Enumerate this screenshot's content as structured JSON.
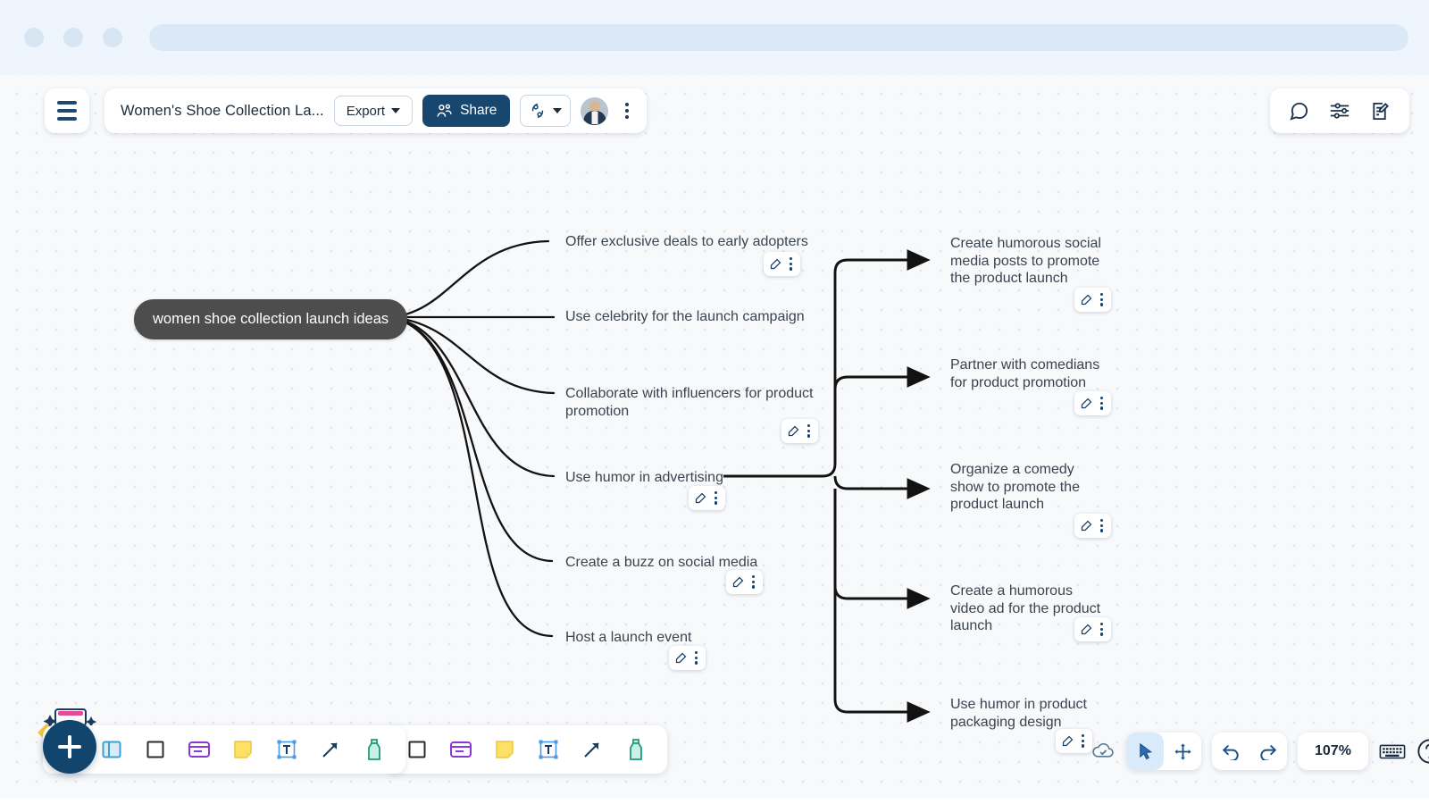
{
  "browser": {
    "dots": [
      "dot-1",
      "dot-2",
      "dot-3"
    ],
    "url_value": ""
  },
  "header": {
    "menu_icon": "hamburger-icon",
    "doc_title": "Women's Shoe Collection La...",
    "export_label": "Export",
    "share_label": "Share",
    "share_icon": "people-icon",
    "collab_icon": "collaborate-icon",
    "avatar_name": "user-avatar",
    "more_icon": "kebab-menu-icon",
    "right_tools": [
      {
        "name": "comment-icon",
        "label": "Comments"
      },
      {
        "name": "sliders-icon",
        "label": "Board settings"
      },
      {
        "name": "edit-note-icon",
        "label": "Notes"
      }
    ]
  },
  "map": {
    "root": {
      "text": "women shoe collection launch ideas"
    },
    "branches": [
      {
        "text": "Offer exclusive deals to early adopters",
        "lines": 1
      },
      {
        "text": "Use celebrity for the launch campaign",
        "lines": 1
      },
      {
        "text": "Collaborate with influencers for product promotion",
        "lines": 2
      },
      {
        "text": "Use humor in advertising",
        "lines": 1
      },
      {
        "text": "Create a buzz on social media",
        "lines": 1
      },
      {
        "text": "Host a launch event",
        "lines": 1
      }
    ],
    "sub_branches": [
      {
        "text": "Create humorous social media posts to promote the product launch",
        "lines": 3
      },
      {
        "text": "Partner with comedians for product promotion",
        "lines": 2
      },
      {
        "text": "Organize a comedy show to promote the product launch",
        "lines": 3
      },
      {
        "text": "Create a humorous video ad for the product launch",
        "lines": 2
      },
      {
        "text": "Use humor in product packaging design",
        "lines": 2
      }
    ],
    "node_tool_edit_icon": "edit-pencil-icon",
    "node_tool_more_icon": "kebab-menu-icon"
  },
  "bottom_toolbar": {
    "add_label": "+",
    "tools": [
      {
        "name": "frame-tool-icon",
        "label": "Frame"
      },
      {
        "name": "shape-tool-icon",
        "label": "Shape"
      },
      {
        "name": "card-tool-icon",
        "label": "Card"
      },
      {
        "name": "sticky-note-tool-icon",
        "label": "Sticky note"
      },
      {
        "name": "text-tool-icon",
        "label": "Text"
      },
      {
        "name": "arrow-tool-icon",
        "label": "Arrow"
      },
      {
        "name": "marker-tool-icon",
        "label": "Marker"
      }
    ]
  },
  "bottom_right": {
    "saved_icon": "cloud-saved-icon",
    "select_icon": "cursor-select-icon",
    "pan_icon": "pan-move-icon",
    "undo_icon": "undo-icon",
    "redo_icon": "redo-icon",
    "zoom_level": "107%",
    "keyboard_icon": "keyboard-shortcuts-icon",
    "help_icon": "help-question-icon"
  },
  "colors": {
    "brand_navy": "#17476f",
    "fab_navy": "#12456e",
    "root_node": "#4d4d4d",
    "canvas": "#f7f9fb",
    "chrome": "#eef5fc",
    "accent_blue": "#d9eafb"
  }
}
